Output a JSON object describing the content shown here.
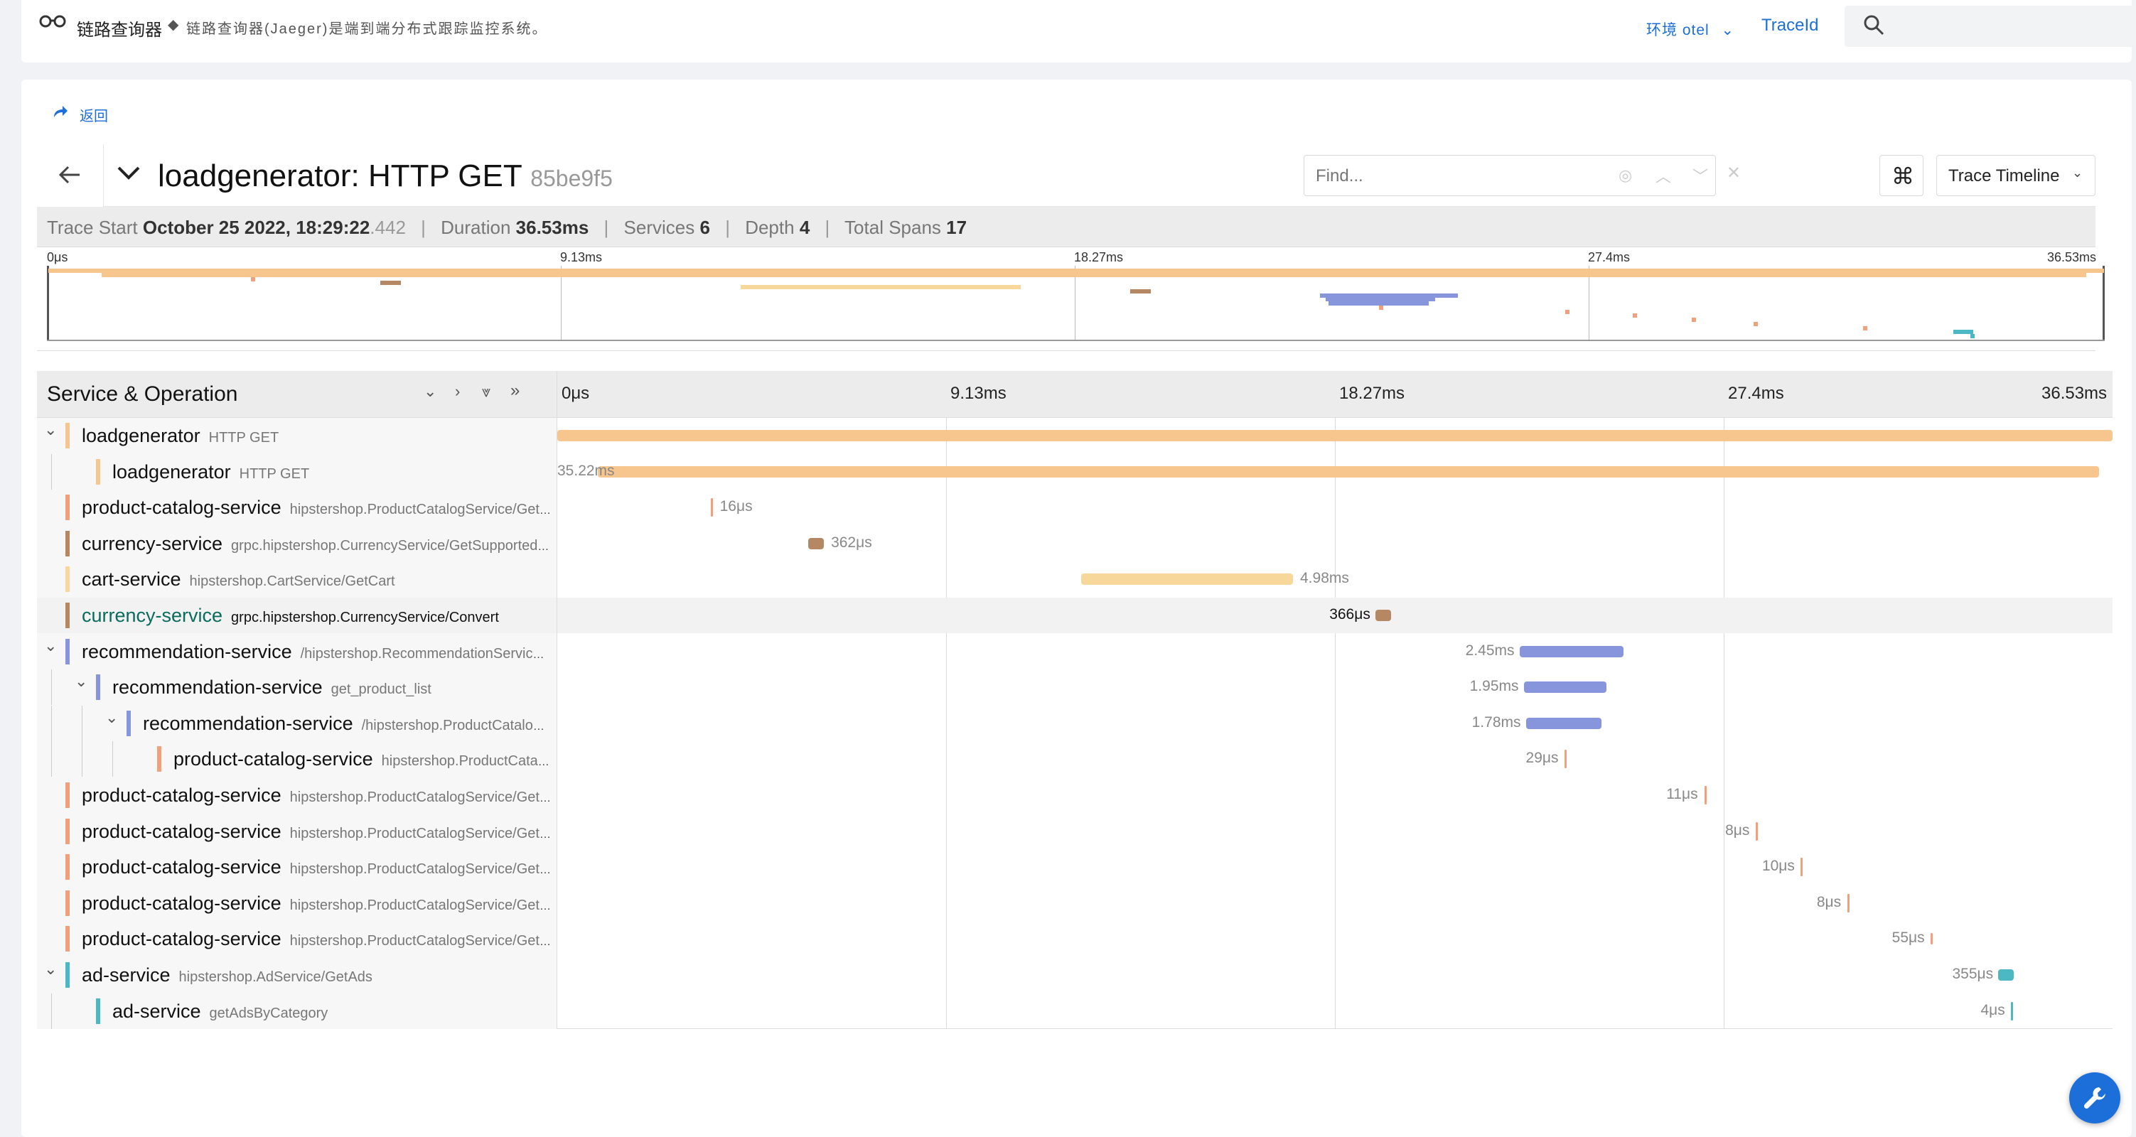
{
  "topbar": {
    "app_title": "链路查询器",
    "description": "链路查询器(Jaeger)是端到端分布式跟踪监控系统。",
    "env_label": "环境 otel",
    "traceid_label": "TraceId",
    "search_placeholder": ""
  },
  "nav": {
    "back_link": "返回"
  },
  "trace": {
    "title": "loadgenerator: HTTP GET",
    "trace_id_short": "85be9f5",
    "find_placeholder": "Find...",
    "view_select": "Trace Timeline",
    "cmd_symbol": "⌘",
    "meta": {
      "trace_start_label": "Trace Start",
      "trace_start_value": "October 25 2022, 18:29:22",
      "trace_start_ms": ".442",
      "duration_label": "Duration",
      "duration_value": "36.53ms",
      "services_label": "Services",
      "services_value": "6",
      "depth_label": "Depth",
      "depth_value": "4",
      "total_spans_label": "Total Spans",
      "total_spans_value": "17"
    }
  },
  "minimap": {
    "ticks": [
      "0μs",
      "9.13ms",
      "18.27ms",
      "27.4ms",
      "36.53ms"
    ]
  },
  "timeline": {
    "header_title": "Service & Operation",
    "ticks": [
      "0μs",
      "9.13ms",
      "18.27ms",
      "27.4ms",
      "36.53ms"
    ],
    "total_ms": 36.53,
    "spans": [
      {
        "service": "loadgenerator",
        "operation": "HTTP GET",
        "depth": 0,
        "collapsible": true,
        "color": "#f7c58e",
        "start_ms": 0,
        "dur_ms": 36.53,
        "label": ""
      },
      {
        "service": "loadgenerator",
        "operation": "HTTP GET",
        "depth": 1,
        "collapsible": false,
        "color": "#f7c58e",
        "start_ms": 0.95,
        "dur_ms": 35.27,
        "label": "35.22ms"
      },
      {
        "service": "product-catalog-service",
        "operation": "hipstershop.ProductCatalogService/GetProduct",
        "depth": 0,
        "collapsible": false,
        "color": "#f0a07a",
        "start_ms": 3.6,
        "dur_ms": 0.016,
        "label": "16μs"
      },
      {
        "service": "currency-service",
        "operation": "grpc.hipstershop.CurrencyService/GetSupportedCurrencies",
        "depth": 0,
        "collapsible": false,
        "color": "#b58863",
        "start_ms": 5.9,
        "dur_ms": 0.362,
        "label": "362μs"
      },
      {
        "service": "cart-service",
        "operation": "hipstershop.CartService/GetCart",
        "depth": 0,
        "collapsible": false,
        "color": "#f7d89a",
        "start_ms": 12.3,
        "dur_ms": 4.98,
        "label": "4.98ms"
      },
      {
        "service": "currency-service",
        "operation": "grpc.hipstershop.CurrencyService/Convert",
        "depth": 0,
        "collapsible": false,
        "color": "#b58863",
        "start_ms": 19.22,
        "dur_ms": 0.366,
        "label": "366μs",
        "selected": true
      },
      {
        "service": "recommendation-service",
        "operation": "/hipstershop.RecommendationService/ListRecommendations",
        "depth": 0,
        "collapsible": true,
        "color": "#8795dc",
        "start_ms": 22.6,
        "dur_ms": 2.45,
        "label": "2.45ms"
      },
      {
        "service": "recommendation-service",
        "operation": "get_product_list",
        "depth": 1,
        "collapsible": true,
        "color": "#8795dc",
        "start_ms": 22.7,
        "dur_ms": 1.95,
        "label": "1.95ms"
      },
      {
        "service": "recommendation-service",
        "operation": "/hipstershop.ProductCatalogService/ListProducts",
        "depth": 2,
        "collapsible": true,
        "color": "#8795dc",
        "start_ms": 22.75,
        "dur_ms": 1.78,
        "label": "1.78ms"
      },
      {
        "service": "product-catalog-service",
        "operation": "hipstershop.ProductCatalogService/ListProducts",
        "depth": 3,
        "collapsible": false,
        "color": "#f0a07a",
        "start_ms": 23.65,
        "dur_ms": 0.029,
        "label": "29μs"
      },
      {
        "service": "product-catalog-service",
        "operation": "hipstershop.ProductCatalogService/GetProduct",
        "depth": 0,
        "collapsible": false,
        "color": "#f0a07a",
        "start_ms": 26.95,
        "dur_ms": 0.011,
        "label": "11μs"
      },
      {
        "service": "product-catalog-service",
        "operation": "hipstershop.ProductCatalogService/GetProduct",
        "depth": 0,
        "collapsible": false,
        "color": "#f0a07a",
        "start_ms": 28.15,
        "dur_ms": 0.008,
        "label": "8μs"
      },
      {
        "service": "product-catalog-service",
        "operation": "hipstershop.ProductCatalogService/GetProduct",
        "depth": 0,
        "collapsible": false,
        "color": "#f0a07a",
        "start_ms": 29.2,
        "dur_ms": 0.01,
        "label": "10μs"
      },
      {
        "service": "product-catalog-service",
        "operation": "hipstershop.ProductCatalogService/GetProduct",
        "depth": 0,
        "collapsible": false,
        "color": "#f0a07a",
        "start_ms": 30.3,
        "dur_ms": 0.008,
        "label": "8μs"
      },
      {
        "service": "product-catalog-service",
        "operation": "hipstershop.ProductCatalogService/GetProduct",
        "depth": 0,
        "collapsible": false,
        "color": "#f0a07a",
        "start_ms": 32.25,
        "dur_ms": 0.055,
        "label": "55μs"
      },
      {
        "service": "ad-service",
        "operation": "hipstershop.AdService/GetAds",
        "depth": 0,
        "collapsible": true,
        "color": "#4cb8c4",
        "start_ms": 33.85,
        "dur_ms": 0.355,
        "label": "355μs"
      },
      {
        "service": "ad-service",
        "operation": "getAdsByCategory",
        "depth": 1,
        "collapsible": false,
        "color": "#4cb8c4",
        "start_ms": 34.15,
        "dur_ms": 0.004,
        "label": "4μs"
      }
    ]
  },
  "fab": {
    "icon": "wrench-icon"
  }
}
